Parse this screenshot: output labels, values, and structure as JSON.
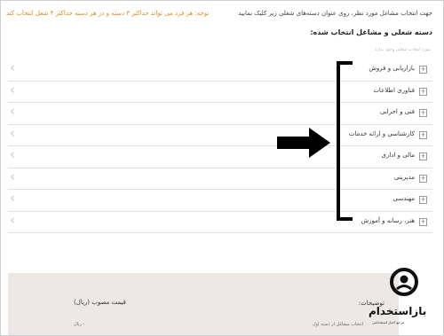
{
  "header": {
    "instruction": "جهت انتخاب مشاغل مورد نظر، روی عنوان دسته‌های شغلی زیر کلیک نمایید",
    "notice": "توجه: هر فرد می تواند حداکثر ۳ دسته و در هر دسته حداکثر ۴ شغل انتخاب کند"
  },
  "section": {
    "title": "دسته شغلی و مشاغل انتخاب شده:",
    "hint": "مورد انتخاب شغلی وجود ندارد"
  },
  "categories": [
    {
      "label": "بازاریابی و فروش"
    },
    {
      "label": "فناوری اطلاعات"
    },
    {
      "label": "فنی و اجرایی"
    },
    {
      "label": "کارشناسی و ارائه خدمات"
    },
    {
      "label": "مالی و اداری"
    },
    {
      "label": "مدیریتی"
    },
    {
      "label": "مهندسی"
    },
    {
      "label": "هنر، رسانه و آموزش"
    }
  ],
  "icons": {
    "expand": "plus-square-icon",
    "collapse": "chevron-left-icon",
    "annotation": "arrow-right-icon"
  },
  "bottom": {
    "description_label": "توضیحات:",
    "price_label": "قیمت مصوب (ریال)",
    "first_field": "انتخاب مشاغل از دسته اول",
    "rial": "- ریال"
  },
  "watermark": {
    "name": "بازاستخدام",
    "sub": "مرجع اخبار استخدامی"
  },
  "colors": {
    "notice": "#e08a1e",
    "panel": "#ede8e6",
    "annotation": "#000000"
  }
}
